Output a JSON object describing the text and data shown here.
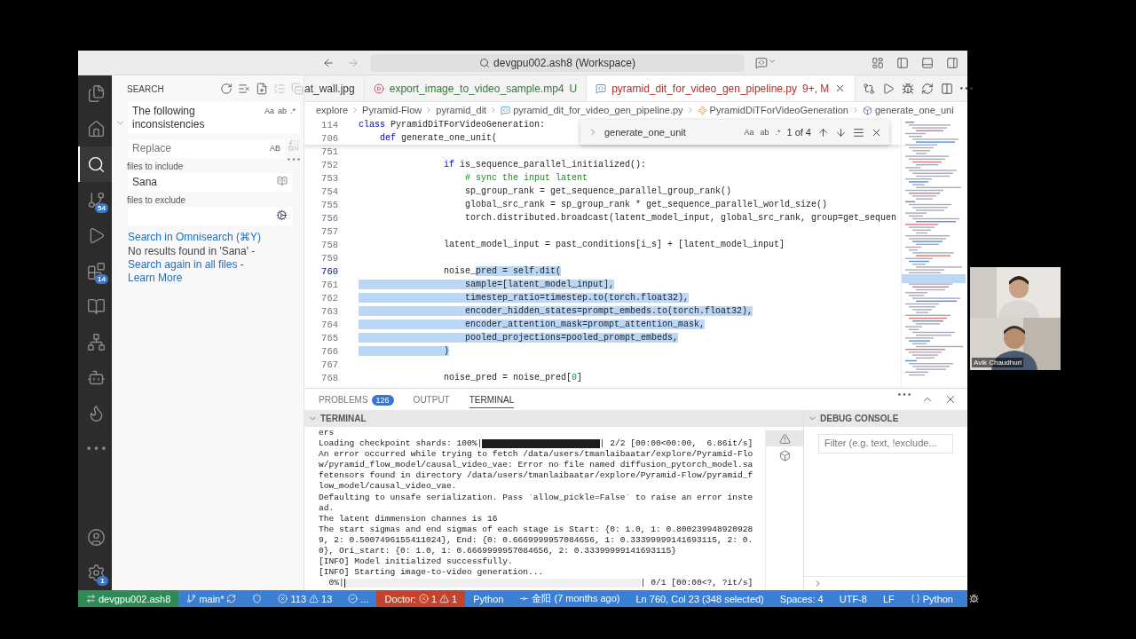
{
  "title_bar": {
    "command_center": "devgpu002.ash8 (Workspace)"
  },
  "activity_bar": {
    "top": [
      {
        "kind": "files",
        "selected": false
      },
      {
        "kind": "home",
        "selected": false
      },
      {
        "kind": "search",
        "selected": true
      },
      {
        "kind": "source-control",
        "selected": false,
        "badge": "54"
      },
      {
        "kind": "run-debug",
        "selected": false
      },
      {
        "kind": "extensions",
        "selected": false,
        "badge": "14"
      },
      {
        "kind": "book",
        "selected": false
      },
      {
        "kind": "tree",
        "selected": false
      },
      {
        "kind": "bot",
        "selected": false
      },
      {
        "kind": "flame",
        "selected": false
      },
      {
        "kind": "more",
        "selected": false
      }
    ],
    "bottom": [
      {
        "kind": "account",
        "selected": false
      },
      {
        "kind": "settings",
        "selected": false,
        "badge": "1"
      }
    ]
  },
  "search_panel": {
    "title": "SEARCH",
    "query": "The following inconsistencies",
    "query_options": [
      "Aa",
      "ab",
      ".*"
    ],
    "replace_placeholder": "Replace",
    "replace_option": "AB",
    "include_label": "files to include",
    "include_value": "Sana",
    "exclude_label": "files to exclude",
    "omnisearch_link": "Search in Omnisearch (⌘Y)",
    "message": [
      {
        "text": "No results found in 'Sana' - ",
        "link": false
      },
      {
        "text": "Search again in all files",
        "link": true
      },
      {
        "text": " - ",
        "link": false
      },
      {
        "text": "Learn More",
        "link": true
      }
    ]
  },
  "tabs": [
    {
      "label": "at_wall.jpg",
      "selected": false,
      "color": "#3b3b3b"
    },
    {
      "label": "export_image_to_video_sample.mp4",
      "kind": "video",
      "status": "U",
      "selected": false,
      "color": "#387a3e"
    },
    {
      "label": "pyramid_dit_for_video_gen_pipeline.py",
      "kind": "python",
      "status": "9+, M",
      "selected": true,
      "color": "#b5302a"
    }
  ],
  "breadcrumbs": [
    {
      "label": "explore",
      "kind": "folder"
    },
    {
      "label": "Pyramid-Flow",
      "kind": "folder"
    },
    {
      "label": "pyramid_dit",
      "kind": "folder"
    },
    {
      "label": "pyramid_dit_for_video_gen_pipeline.py",
      "kind": "python"
    },
    {
      "label": "PyramidDiTForVideoGeneration",
      "kind": "class"
    },
    {
      "label": "generate_one_uni",
      "kind": "method"
    }
  ],
  "find_widget": {
    "query": "generate_one_unit",
    "options": [
      "Aa",
      "ab",
      ".*"
    ],
    "count": "1 of 4"
  },
  "code": {
    "sticky": [
      {
        "number": "114",
        "current": false,
        "segments": [
          {
            "text": "class",
            "kind": "keyword",
            "selected": false
          },
          {
            "text": " PyramidDiTForVideoGeneration:",
            "kind": "plain",
            "selected": false
          }
        ]
      },
      {
        "number": "706",
        "current": false,
        "segments": [
          {
            "text": "    def",
            "kind": "keyword",
            "selected": false
          },
          {
            "text": " generate_one_unit(",
            "kind": "plain",
            "selected": false
          }
        ]
      }
    ],
    "lines": [
      {
        "number": "751",
        "current": false
      },
      {
        "number": "752",
        "current": false,
        "segments": [
          {
            "text": "                if",
            "kind": "keyword",
            "selected": false
          },
          {
            "text": " is_sequence_parallel_initialized():",
            "kind": "plain",
            "selected": false
          }
        ]
      },
      {
        "number": "753",
        "current": false,
        "segments": [
          {
            "text": "                    # sync the input latent",
            "kind": "comment",
            "selected": false
          }
        ]
      },
      {
        "number": "754",
        "current": false,
        "segments": [
          {
            "text": "                    sp_group_rank = get_sequence_parallel_group_rank()",
            "kind": "plain",
            "selected": false
          }
        ]
      },
      {
        "number": "755",
        "current": false,
        "segments": [
          {
            "text": "                    global_src_rank = sp_group_rank * get_sequence_parallel_world_size()",
            "kind": "plain",
            "selected": false
          }
        ]
      },
      {
        "number": "756",
        "current": false,
        "segments": [
          {
            "text": "                    torch.distributed.broadcast(latent_model_input, global_src_rank, group=get_sequen",
            "kind": "plain",
            "selected": false
          }
        ]
      },
      {
        "number": "757",
        "current": false
      },
      {
        "number": "758",
        "current": false,
        "segments": [
          {
            "text": "                latent_model_input = past_conditions[i_s] + [latent_model_input]",
            "kind": "plain",
            "selected": false
          }
        ]
      },
      {
        "number": "759",
        "current": false
      },
      {
        "number": "760",
        "current": true,
        "segments": [
          {
            "text": "                noise_",
            "kind": "plain",
            "selected": false
          },
          {
            "text": "pred = self.dit(",
            "kind": "plain",
            "selected": true
          }
        ]
      },
      {
        "number": "761",
        "current": false,
        "segments": [
          {
            "text": "                    sample=[latent_model_input],",
            "kind": "plain",
            "selected": true
          }
        ]
      },
      {
        "number": "762",
        "current": false,
        "segments": [
          {
            "text": "                    timestep_ratio=timestep.to(torch.float32),",
            "kind": "plain",
            "selected": true
          }
        ]
      },
      {
        "number": "763",
        "current": false,
        "segments": [
          {
            "text": "                    encoder_hidden_states=prompt_embeds.to(torch.float32),",
            "kind": "plain",
            "selected": true
          }
        ]
      },
      {
        "number": "764",
        "current": false,
        "segments": [
          {
            "text": "                    encoder_attention_mask=prompt_attention_mask,",
            "kind": "plain",
            "selected": true
          }
        ]
      },
      {
        "number": "765",
        "current": false,
        "segments": [
          {
            "text": "                    pooled_projections=pooled_prompt_embeds,",
            "kind": "plain",
            "selected": true
          }
        ]
      },
      {
        "number": "766",
        "current": false,
        "segments": [
          {
            "text": "                )",
            "kind": "plain",
            "selected": true
          }
        ]
      },
      {
        "number": "767",
        "current": false
      },
      {
        "number": "768",
        "current": false,
        "segments": [
          {
            "text": "                noise_pred = noise_pred[",
            "kind": "plain",
            "selected": false
          },
          {
            "text": "0",
            "kind": "number",
            "selected": false
          },
          {
            "text": "]",
            "kind": "plain",
            "selected": false
          }
        ]
      }
    ]
  },
  "panel": {
    "tabs": [
      {
        "label": "PROBLEMS",
        "badge": "126",
        "selected": false
      },
      {
        "label": "OUTPUT",
        "selected": false
      },
      {
        "label": "TERMINAL",
        "selected": true
      }
    ],
    "terminal": {
      "title": "TERMINAL",
      "lines": [
        {
          "kind": "text",
          "text": "ers"
        },
        {
          "kind": "progress",
          "prefix": "Loading checkpoint shards: 100%|",
          "level": 1,
          "suffix": "| 2/2 [00:00<00:00,  6.86it/s]"
        },
        {
          "kind": "text",
          "text": "An error occurred while trying to fetch /data/users/tmanlaibaatar/explore/Pyramid-Flow/pyramid_flow_model/causal_video_vae: Error no file named diffusion_pytorch_model.safetensors found in directory /data/users/tmanlaibaatar/explore/Pyramid-Flow/pyramid_flow_model/causal_video_vae."
        },
        {
          "kind": "text",
          "text": "Defaulting to unsafe serialization. Pass `allow_pickle=False` to raise an error instead."
        },
        {
          "kind": "text",
          "text": "The latent dimmension channes is 16"
        },
        {
          "kind": "text",
          "text": "The start sigmas and end sigmas of each stage is Start: {0: 1.0, 1: 0.8002399489209289, 2: 0.5007496155411024}, End: {0: 0.6669999957084656, 1: 0.33399999141693115, 2: 0.0}, Ori_start: {0: 1.0, 1: 0.6669999957084656, 2: 0.33399999141693115}"
        },
        {
          "kind": "text",
          "text": "[INFO] Model initialized successfully."
        },
        {
          "kind": "text",
          "text": "[INFO] Starting image-to-video generation..."
        },
        {
          "kind": "progress",
          "prefix": "  0%|",
          "level": 0,
          "suffix": "| 0/1 [00:00<?, ?it/s]"
        }
      ]
    },
    "debug_console": {
      "title": "DEBUG CONSOLE",
      "filter_placeholder": "Filter (e.g. text, !exclude..."
    }
  },
  "status_bar": [
    {
      "kind": "remote",
      "text": "devgpu002.ash8"
    },
    {
      "kind": "branch",
      "text": "main*"
    },
    {
      "kind": "vpn"
    },
    {
      "kind": "problems",
      "errors": "113",
      "warnings": "13"
    },
    {
      "kind": "check",
      "text": "..."
    },
    {
      "kind": "doctor",
      "text": "Doctor:",
      "errors": "1",
      "warnings": "1"
    },
    {
      "kind": "plain",
      "text": "Python"
    },
    {
      "kind": "blame",
      "text": "金阳 (7 months ago)"
    },
    {
      "kind": "plain",
      "text": "Ln 760, Col 23 (348 selected)"
    },
    {
      "kind": "plain",
      "text": "Spaces: 4"
    },
    {
      "kind": "plain",
      "text": "UTF-8"
    },
    {
      "kind": "plain",
      "text": "LF"
    },
    {
      "kind": "language",
      "text": "Python"
    },
    {
      "kind": "bug"
    }
  ],
  "video_call": {
    "participant": "Avik Chaudhuri"
  }
}
